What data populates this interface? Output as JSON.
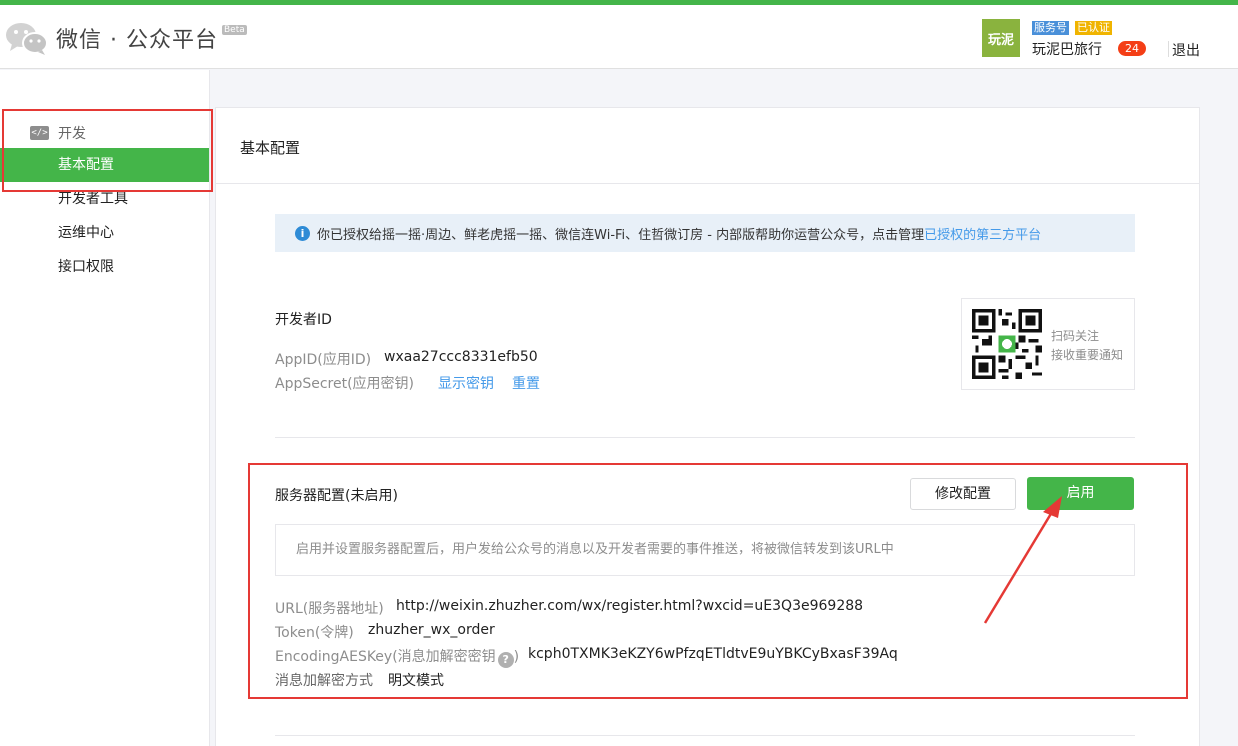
{
  "header": {
    "title": "微信 · 公众平台",
    "beta": "Beta",
    "account": {
      "avatar_text": "玩泥",
      "tag_service": "服务号",
      "tag_verified": "已认证",
      "name": "玩泥巴旅行",
      "notification_count": "24",
      "logout": "退出"
    }
  },
  "sidebar": {
    "section": "开发",
    "items": [
      {
        "label": "基本配置",
        "active": true
      },
      {
        "label": "开发者工具",
        "active": false
      },
      {
        "label": "运维中心",
        "active": false
      },
      {
        "label": "接口权限",
        "active": false
      }
    ]
  },
  "main": {
    "title": "基本配置",
    "notice": {
      "text": "你已授权给摇一摇·周边、鲜老虎摇一摇、微信连Wi-Fi、住哲微订房 - 内部版帮助你运营公众号，点击管理",
      "link": "已授权的第三方平台"
    },
    "developer": {
      "title": "开发者ID",
      "appid_label": "AppID(应用ID)",
      "appid_value": "wxaa27ccc8331efb50",
      "secret_label": "AppSecret(应用密钥)",
      "show_secret": "显示密钥",
      "reset": "重置",
      "qr_line1": "扫码关注",
      "qr_line2": "接收重要通知"
    },
    "server": {
      "title": "服务器配置(未启用)",
      "modify_button": "修改配置",
      "enable_button": "启用",
      "description": "启用并设置服务器配置后，用户发给公众号的消息以及开发者需要的事件推送，将被微信转发到该URL中",
      "url_label": "URL(服务器地址)",
      "url_value": "http://weixin.zhuzher.com/wx/register.html?wxcid=uE3Q3e969288",
      "token_label": "Token(令牌)",
      "token_value": "zhuzher_wx_order",
      "aes_label": "EncodingAESKey(消息加解密密钥",
      "aes_label_end": ")",
      "aes_value": "kcph0TXMK3eKZY6wPfzqETldtvE9uYBKCyBxasF39Aq",
      "mode_label": "消息加解密方式",
      "mode_value": "明文模式"
    }
  },
  "colors": {
    "brand_green": "#44b549",
    "link_blue": "#459ae9",
    "annotation_red": "#e53935"
  }
}
